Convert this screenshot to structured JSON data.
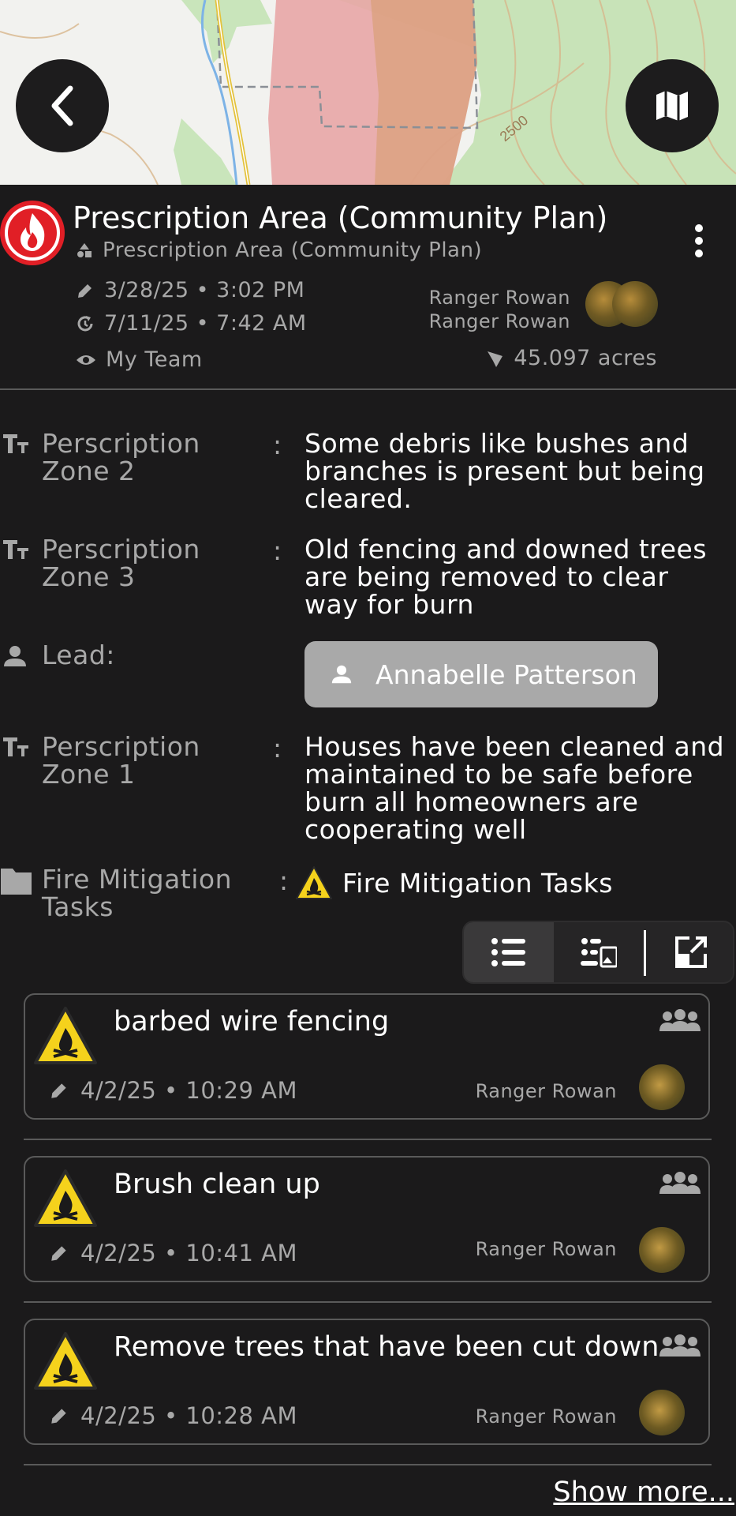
{
  "header": {
    "title": "Prescription Area (Community Plan)",
    "subtitle": "Prescription Area (Community Plan)",
    "created": "3/28/25 • 3:02 PM",
    "updated": "7/11/25 • 7:42 AM",
    "visibility": "My Team",
    "created_by": "Ranger Rowan",
    "updated_by": "Ranger Rowan",
    "area": "45.097 acres"
  },
  "map": {
    "contour_label": "2500"
  },
  "fields": [
    {
      "label": "Perscription Zone 2",
      "value": "Some debris like bushes and branches is present but being cleared."
    },
    {
      "label": "Perscription Zone 3",
      "value": "Old fencing and downed trees are being removed to clear way for burn"
    },
    {
      "label": "Lead:",
      "value": "Annabelle Patterson"
    },
    {
      "label": "Perscription Zone 1",
      "value": "Houses have been cleaned and maintained to be safe before burn all homeowners are cooperating well"
    },
    {
      "label": "Fire Mitigation Tasks",
      "value": "Fire Mitigation Tasks"
    }
  ],
  "colon": ":",
  "tasks": [
    {
      "title": "barbed wire fencing",
      "date": "4/2/25 • 10:29 AM",
      "user": "Ranger Rowan"
    },
    {
      "title": "Brush clean up",
      "date": "4/2/25 • 10:41 AM",
      "user": "Ranger Rowan"
    },
    {
      "title": "Remove trees that have been cut down",
      "date": "4/2/25 • 10:28 AM",
      "user": "Ranger Rowan"
    }
  ],
  "show_more": "Show more...",
  "colors": {
    "background": "#1b1a1b",
    "fire_red": "#e11f26",
    "muted_text": "#a8a8a8",
    "pill": "#a9a9a9",
    "warning_yellow": "#f5d21c"
  }
}
